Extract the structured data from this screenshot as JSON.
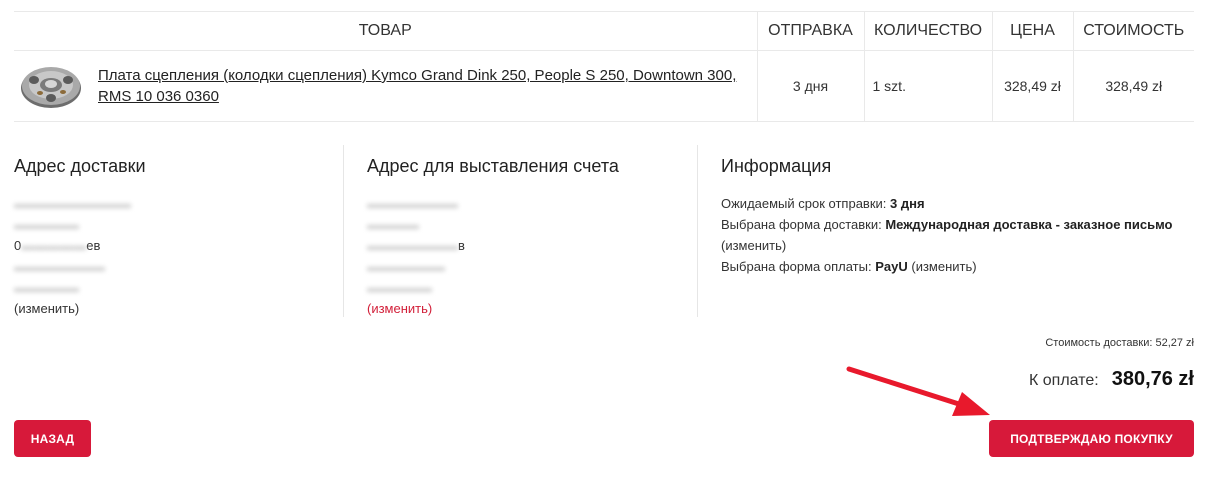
{
  "table": {
    "headers": {
      "product": "ТОВАР",
      "shipping": "ОТПРАВКА",
      "quantity": "КОЛИЧЕСТВО",
      "price": "ЦЕНА",
      "total": "СТОИМОСТЬ"
    },
    "row": {
      "product_name": "Плата сцепления (колодки сцепления) Kymco Grand Dink 250, People S 250, Downtown 300, RMS 10 036 0360",
      "shipping": "3 дня",
      "quantity": "1 szt.",
      "price": "328,49 zł",
      "total": "328,49 zł"
    }
  },
  "delivery_address": {
    "title": "Адрес доставки",
    "line3_suffix": "ев",
    "line3_prefix": "0",
    "change_label": "(изменить)"
  },
  "billing_address": {
    "title": "Адрес для выставления счета",
    "line3_suffix": "в",
    "change_label": "(изменить)"
  },
  "information": {
    "title": "Информация",
    "expected_label": "Ожидаемый срок отправки:",
    "expected_value": "3 дня",
    "delivery_label": "Выбрана форма доставки:",
    "delivery_value": "Международная доставка - заказное письмо",
    "payment_label": "Выбрана форма оплаты:",
    "payment_value": "PayU",
    "change_label": "(изменить)"
  },
  "totals": {
    "shipping_cost": "Стоимость доставки: 52,27 zł",
    "to_pay_label": "К оплате:",
    "to_pay_amount": "380,76 zł"
  },
  "buttons": {
    "back": "НАЗАД",
    "confirm": "ПОДТВЕРЖДАЮ ПОКУПКУ"
  },
  "colors": {
    "accent": "#d7193a",
    "arrow": "#e8192c"
  }
}
